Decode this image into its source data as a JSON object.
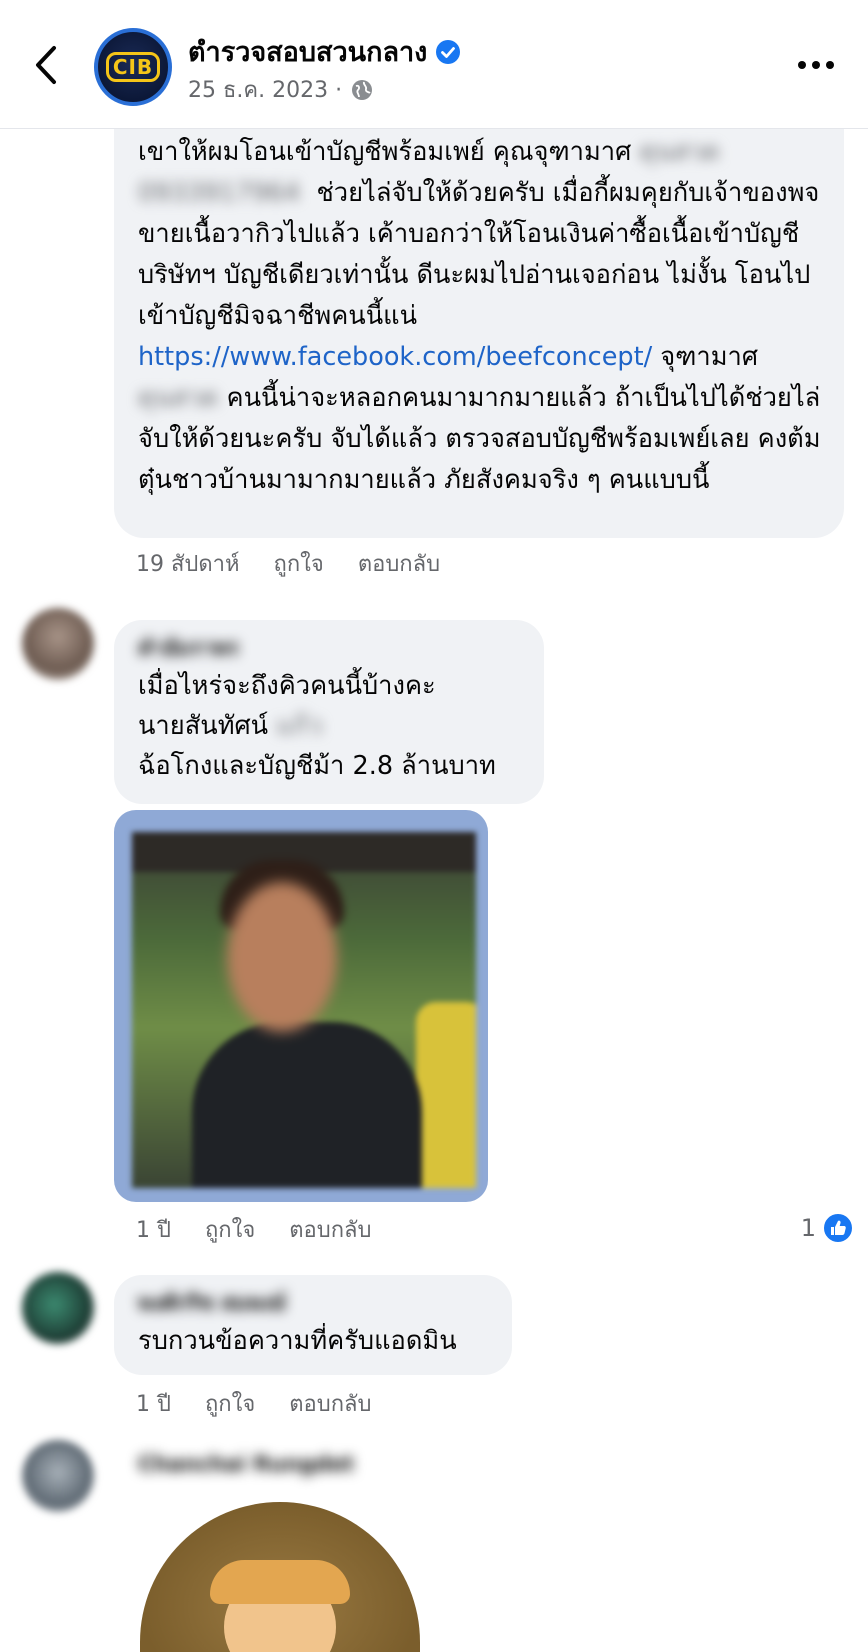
{
  "header": {
    "page_name": "ตำรวจสอบสวนกลาง",
    "logo_text": "CIB",
    "post_date": "25 ธ.ค. 2023 ·",
    "icons": {
      "back": "chevron-left-icon",
      "verified": "verified-badge-icon",
      "audience": "globe-icon",
      "more": "more-dots-icon"
    }
  },
  "comments": [
    {
      "segments": [
        {
          "t": "เขาให้ผมโอนเข้าบัญชีพร้อมเพย์ คุณจุฑามาศ "
        },
        {
          "t": "ดุนสวด",
          "blur": true
        },
        {
          "t": "\n"
        },
        {
          "t": "0933917964",
          "blur": true
        },
        {
          "t": "  ช่วยไล่จับให้ด้วยครับ เมื่อกี้ผมคุยกับเจ้าของพจขายเนื้อวากิวไปแล้ว เค้าบอกว่าให้โอนเงินค่าซื้อเนื้อเข้าบัญชีบริษัทฯ บัญชีเดียวเท่านั้น ดีนะผมไปอ่านเจอก่อน ไม่งั้น โอนไปเข้าบัญชีมิจฉาชีพคนนี้แน่ "
        },
        {
          "t": "https://www.facebook.com/beefconcept/",
          "link": true
        },
        {
          "t": " จุฑามาศ "
        },
        {
          "t": "ดุนสวด",
          "blur": true
        },
        {
          "t": " คนนี้น่าจะหลอกคนมามากมายแล้ว ถ้าเป็นไปได้ช่วยไล่จับให้ด้วยนะครับ จับได้แล้ว ตรวจสอบบัญชีพร้อมเพย์เลย คงต้มตุ๋นชาวบ้านมามากมายแล้ว ภัยสังคมจริง ๆ คนแบบนี้"
        }
      ],
      "time": "19 สัปดาห์",
      "like_label": "ถูกใจ",
      "reply_label": "ตอบกลับ"
    },
    {
      "author": "คำอัมราพร",
      "lines": [
        "เมื่อไหร่จะถึงคิวคนนี้บ้างคะ",
        "นายสันทัศน์",
        "ฉ้อโกงและบัญชีม้า 2.8 ล้านบาท"
      ],
      "blurred_word": "แก้ว",
      "time": "1 ปี",
      "like_label": "ถูกใจ",
      "reply_label": "ตอบกลับ",
      "reactions": "1",
      "avatar_color": "#7a6a60"
    },
    {
      "author": "พงศ์กริช สมพงษ์",
      "text": "รบกวนข้อความที่ครับแอดมิน",
      "time": "1 ปี",
      "like_label": "ถูกใจ",
      "reply_label": "ตอบกลับ",
      "avatar_color": "#2f5a4a"
    },
    {
      "author": "Chanchai Rungdet",
      "avatar_color": "#7d8894"
    }
  ],
  "colors": {
    "bubble": "#f0f2f5",
    "link": "#1e64c8",
    "meta": "#65676b",
    "accent": "#1877f2"
  }
}
